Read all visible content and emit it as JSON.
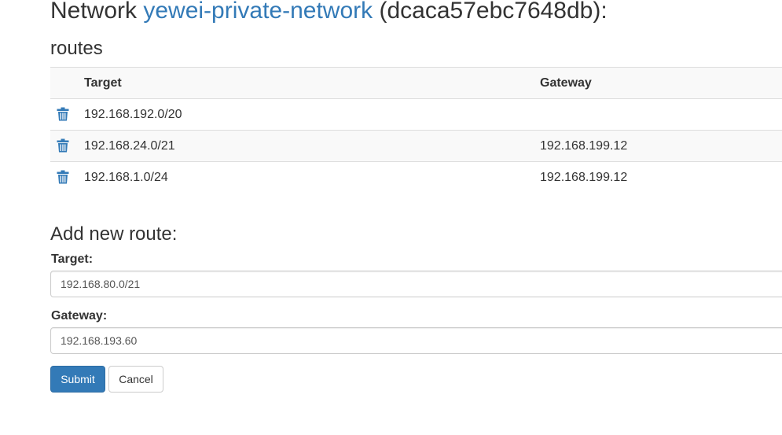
{
  "header": {
    "prefix": "Network ",
    "network_name": "yewei-private-network",
    "network_id": " (dcaca57ebc7648db):"
  },
  "routes": {
    "heading": "routes",
    "columns": {
      "target": "Target",
      "gateway": "Gateway"
    },
    "rows": [
      {
        "target": "192.168.192.0/20",
        "gateway": ""
      },
      {
        "target": "192.168.24.0/21",
        "gateway": "192.168.199.12"
      },
      {
        "target": "192.168.1.0/24",
        "gateway": "192.168.199.12"
      }
    ]
  },
  "add_route": {
    "heading": "Add new route:",
    "target_label": "Target:",
    "target_value": "192.168.80.0/21",
    "gateway_label": "Gateway:",
    "gateway_value": "192.168.193.60",
    "submit_label": "Submit",
    "cancel_label": "Cancel"
  },
  "colors": {
    "link": "#337ab7",
    "primary_button": "#337ab7",
    "trash_icon": "#337ab7"
  },
  "icons": {
    "delete": "trash-icon"
  }
}
